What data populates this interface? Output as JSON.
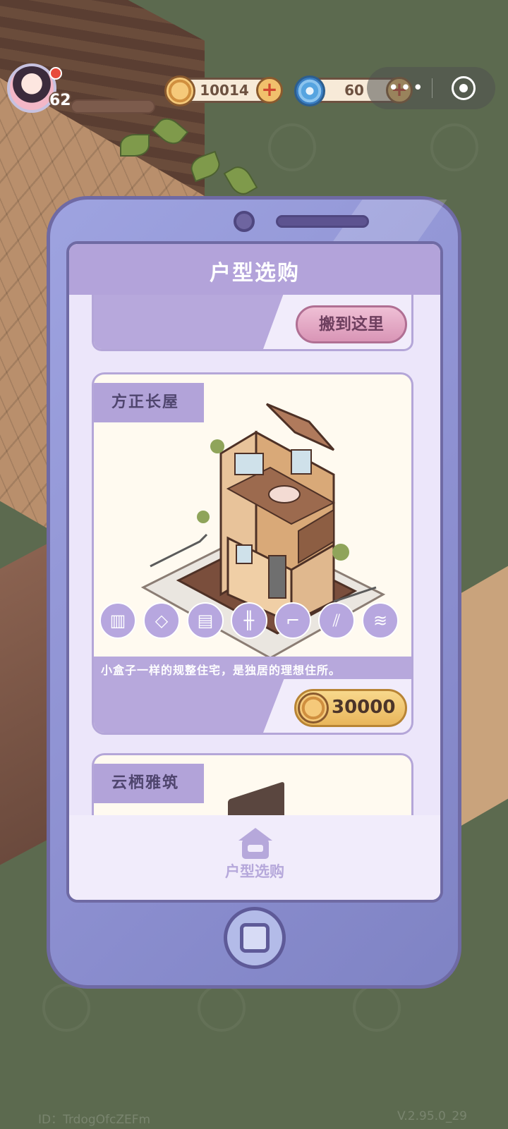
{
  "hud": {
    "level": "62",
    "coins": "10014",
    "gems": "60"
  },
  "screen": {
    "title": "户型选购",
    "cards": [
      {
        "action_label": "搬到这里"
      },
      {
        "name": "方正长屋",
        "description": "小盒子一样的规整住宅，是独居的理想住所。",
        "price": "30000",
        "feature_icons": [
          "wall-icon",
          "floor-icon",
          "window-icon",
          "fence-icon",
          "stairs-icon",
          "railing-icon",
          "roof-icon"
        ]
      },
      {
        "name": "云栖雅筑"
      }
    ],
    "tab_label": "户型选购"
  },
  "footer": {
    "id_text": "ID：TrdogOfcZEFm",
    "version": "V.2.95.0_29"
  },
  "colors": {
    "background": "#5c6a4f",
    "phone_body": "#8c8fd0",
    "header": "#b3a3da",
    "move_button": "#d995b6",
    "price_button": "#e9b65c"
  }
}
